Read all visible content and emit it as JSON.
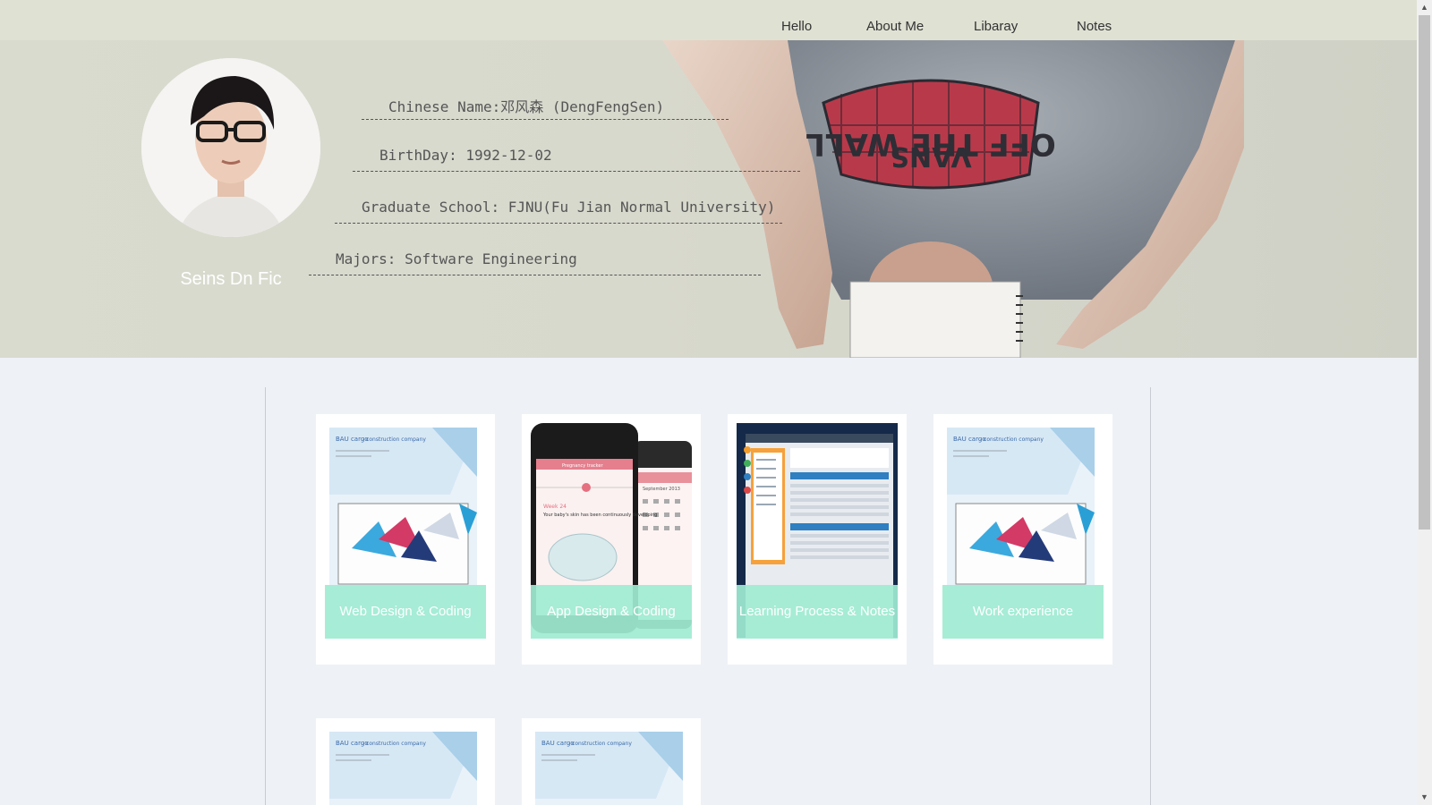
{
  "nav": {
    "items": [
      {
        "label": "Hello"
      },
      {
        "label": "About Me"
      },
      {
        "label": "Libaray"
      },
      {
        "label": "Notes"
      }
    ]
  },
  "profile": {
    "nickname": "Seins Dn Fic",
    "info": [
      "Chinese Name:邓风森 (DengFengSen)",
      "BirthDay: 1992-12-02",
      "Graduate School: FJNU(Fu Jian Normal University)",
      "Majors: Software Engineering"
    ],
    "shirt_text": "OFF THE WALL",
    "shirt_brand": "VANS"
  },
  "cards": [
    {
      "label": "Web Design & Coding"
    },
    {
      "label": "App Design & Coding"
    },
    {
      "label": "Learning Process & Notes"
    },
    {
      "label": "Work experience"
    }
  ],
  "thumb_texts": {
    "bau": "BAU cargo",
    "bau_sub": "- construction company",
    "app_top": "Pregnancy tracker",
    "app_week": "Week 24",
    "app_msg": "Your baby's skin has been continuously developing",
    "app_month": "September 2013"
  },
  "colors": {
    "nav_bg": "#dfe1d3",
    "card_label_bg": "#a0ebd2",
    "page_bg": "#eef1f6"
  }
}
